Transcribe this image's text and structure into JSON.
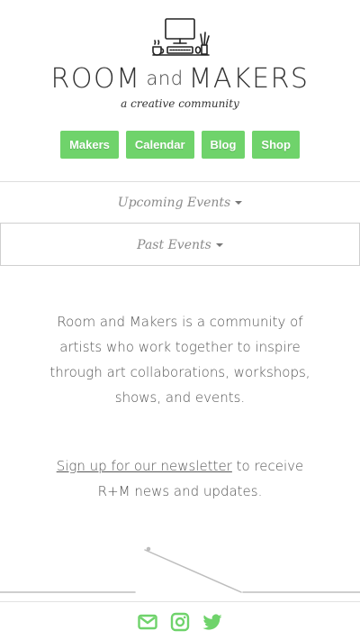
{
  "brand": {
    "title_left": "ROOM",
    "title_and": "and",
    "title_right": "MAKERS",
    "tagline": "a creative community",
    "logo_icon": "workspace-desk-icon"
  },
  "nav": {
    "items": [
      {
        "label": "Makers"
      },
      {
        "label": "Calendar"
      },
      {
        "label": "Blog"
      },
      {
        "label": "Shop"
      }
    ],
    "button_color": "#6fd36b"
  },
  "events": {
    "upcoming_label": "Upcoming Events",
    "past_label": "Past Events"
  },
  "about": {
    "text": "Room and Makers is a community of artists who work together to inspire through art collaborations, workshops, shows, and events."
  },
  "newsletter": {
    "link_text": "Sign up for our newsletter",
    "rest_text": " to receive R+M news and updates."
  },
  "footer": {
    "icons": [
      "mail-icon",
      "instagram-icon",
      "twitter-icon"
    ],
    "icon_color": "#6fd36b"
  }
}
